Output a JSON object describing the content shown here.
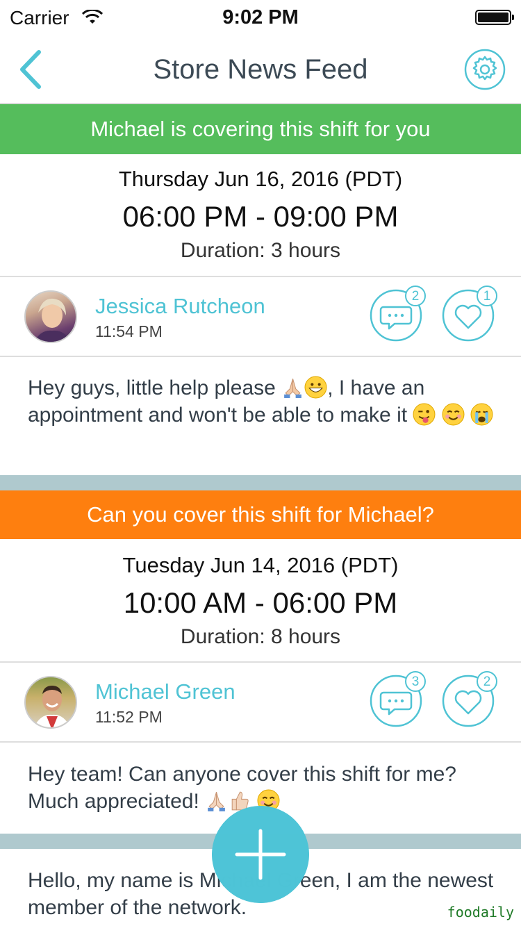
{
  "status_bar": {
    "carrier": "Carrier",
    "time": "9:02 PM"
  },
  "nav": {
    "title": "Store News Feed"
  },
  "posts": [
    {
      "banner": "Michael is covering this shift for you",
      "banner_color": "#55bd5c",
      "date": "Thursday Jun 16, 2016 (PDT)",
      "hours": "06:00 PM - 09:00 PM",
      "duration": "Duration: 3 hours",
      "author": "Jessica Rutcheon",
      "time": "11:54 PM",
      "comments": "2",
      "likes": "1",
      "message_a": "Hey guys, little help please ",
      "message_b": ", I have an appointment and won't be able to make it "
    },
    {
      "banner": "Can you cover this shift for Michael?",
      "banner_color": "#fe7f0f",
      "date": "Tuesday Jun 14, 2016 (PDT)",
      "hours": "10:00 AM - 06:00 PM",
      "duration": "Duration: 8 hours",
      "author": "Michael Green",
      "time": "11:52 PM",
      "comments": "3",
      "likes": "2",
      "message_a": "Hey team! Can anyone cover this shift for me? Much appreciated! "
    }
  ],
  "partial_post": {
    "message": "Hello, my name is Michael Green, I am the newest member of the network."
  },
  "watermark": "foodaily",
  "colors": {
    "accent": "#4fc3d4",
    "separator": "#afc9ce"
  }
}
